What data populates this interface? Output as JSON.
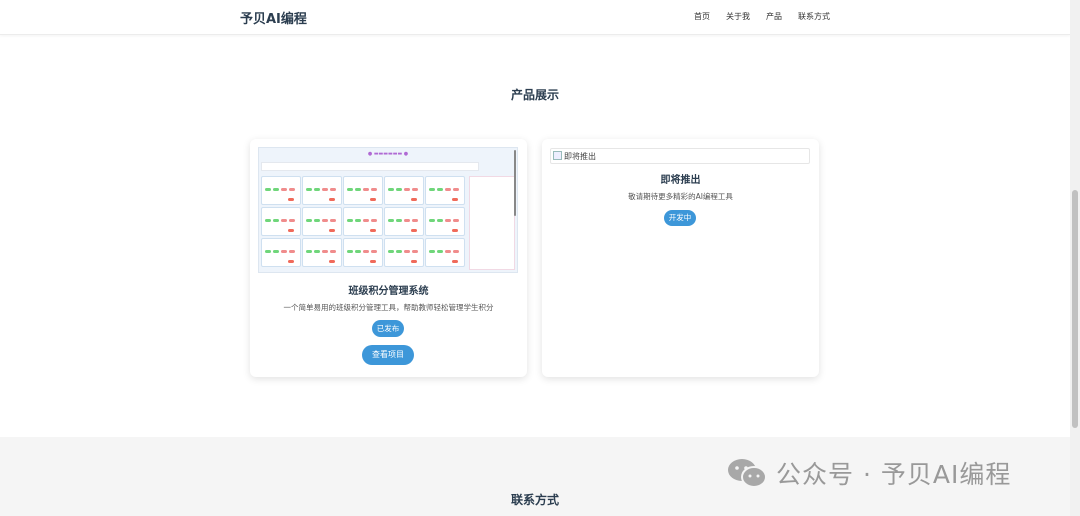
{
  "header": {
    "logo": "予贝AI编程",
    "nav": [
      "首页",
      "关于我",
      "产品",
      "联系方式"
    ]
  },
  "products": {
    "title": "产品展示",
    "cards": [
      {
        "image_alt": "",
        "title": "班级积分管理系统",
        "description": "一个简单易用的班级积分管理工具，帮助教师轻松管理学生积分",
        "status": "已发布",
        "action": "查看项目"
      },
      {
        "image_alt": "即将推出",
        "title": "即将推出",
        "description": "敬请期待更多精彩的AI编程工具",
        "status": "开发中"
      }
    ]
  },
  "contact": {
    "title": "联系方式"
  },
  "watermark": {
    "text": "公众号 · 予贝AI编程",
    "icon": "wechat-icon"
  },
  "colors": {
    "accent": "#3d97d9",
    "title": "#2c3e50",
    "contact_bg": "#f5f5f5"
  }
}
